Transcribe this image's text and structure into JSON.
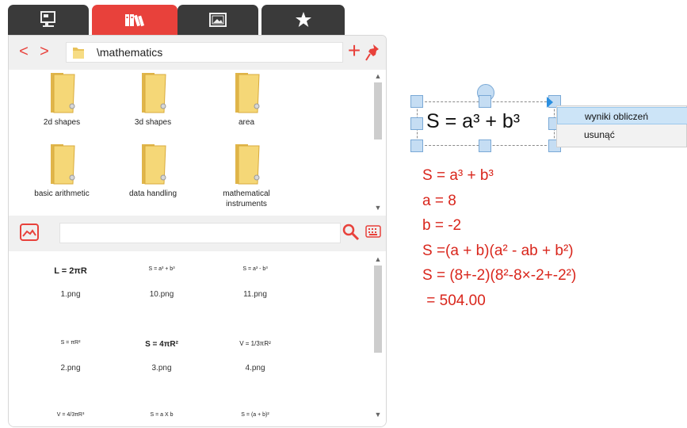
{
  "tabs": [
    {
      "icon": "computer-icon",
      "active": false
    },
    {
      "icon": "library-icon",
      "active": true
    },
    {
      "icon": "image-icon",
      "active": false
    },
    {
      "icon": "star-icon",
      "active": false
    }
  ],
  "path": {
    "current": "\\mathematics",
    "back_glyph": "<",
    "forward_glyph": ">",
    "add_glyph": "+"
  },
  "folders": [
    {
      "label": "2d shapes"
    },
    {
      "label": "3d shapes"
    },
    {
      "label": "area"
    },
    {
      "label": "basic arithmetic"
    },
    {
      "label": "data handling"
    },
    {
      "label": "mathematical instruments"
    }
  ],
  "search": {
    "value": ""
  },
  "images": [
    {
      "formula": "L = 2πR",
      "file": "1.png"
    },
    {
      "formula": "S = a³ + b³",
      "file": "10.png"
    },
    {
      "formula": "S = a³ - b³",
      "file": "11.png"
    },
    {
      "formula": "S = πR²",
      "file": "2.png"
    },
    {
      "formula": "S = 4πR²",
      "file": "3.png"
    },
    {
      "formula": "V = 1/3πR²",
      "file": "4.png"
    },
    {
      "formula": "V = 4/3πR³",
      "file": ""
    },
    {
      "formula": "S = a X b",
      "file": ""
    },
    {
      "formula": "S = (a + b)²",
      "file": ""
    }
  ],
  "selected_formula": "S = a³ + b³",
  "context_menu": {
    "items": [
      "wyniki obliczeń",
      "usunąć"
    ],
    "highlighted": 0
  },
  "calculation": {
    "lines": [
      "S = a³ + b³",
      "a = 8",
      "b = -2",
      "S =(a + b)(a² - ab + b²)",
      "S = (8+-2)(8²-8×-2+-2²)",
      " = 504.00"
    ],
    "color": "#d9261c"
  },
  "colors": {
    "accent": "#e8413b",
    "tab_dark": "#3a3a3a",
    "selection": "#c5ddf3"
  }
}
